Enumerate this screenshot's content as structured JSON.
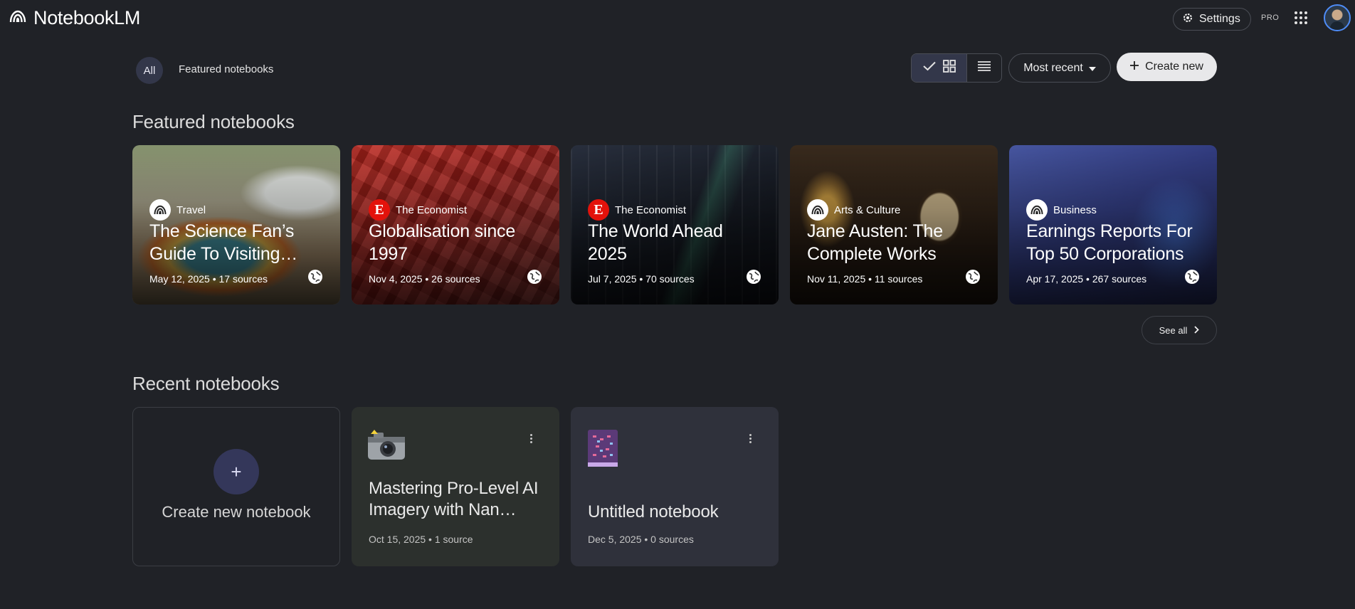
{
  "header": {
    "app_name": "NotebookLM",
    "settings_label": "Settings",
    "plan_badge": "PRO"
  },
  "filters": {
    "all_label": "All",
    "featured_label": "Featured notebooks"
  },
  "toolbar": {
    "sort_label": "Most recent",
    "create_label": "Create new"
  },
  "featured": {
    "heading": "Featured notebooks",
    "see_all_label": "See all",
    "cards": [
      {
        "source": "Travel",
        "title": "The Science Fan’s Guide To Visiting…",
        "meta": "May 12, 2025 • 17 sources"
      },
      {
        "source": "The Economist",
        "title": "Globalisation since 1997",
        "meta": "Nov 4, 2025 • 26 sources"
      },
      {
        "source": "The Economist",
        "title": "The World Ahead 2025",
        "meta": "Jul 7, 2025 • 70 sources"
      },
      {
        "source": "Arts & Culture",
        "title": "Jane Austen: The Complete Works",
        "meta": "Nov 11, 2025 • 11 sources"
      },
      {
        "source": "Business",
        "title": "Earnings Reports For Top 50 Corporations",
        "meta": "Apr 17, 2025 • 267 sources"
      }
    ],
    "economist_logo_letter": "E"
  },
  "recent": {
    "heading": "Recent notebooks",
    "create_label": "Create new notebook",
    "create_plus": "+",
    "cards": [
      {
        "emoji": "📸",
        "title": "Mastering Pro-Level AI Imagery with Nan…",
        "meta": "Oct 15, 2025 • 1 source"
      },
      {
        "emoji": "📓",
        "title": "Untitled notebook",
        "meta": "Dec 5, 2025 • 0 sources"
      }
    ]
  },
  "colors": {
    "background": "#202227",
    "accent_chip": "#33374a",
    "create_button": "#e8e8ea",
    "economist_red": "#e3120b"
  }
}
